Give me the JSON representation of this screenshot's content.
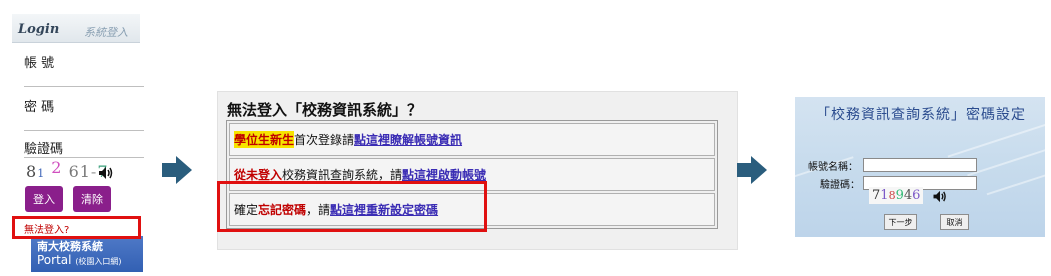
{
  "login_panel": {
    "logo_title": "Login",
    "logo_subtitle": "系統登入",
    "account_label": "帳 號",
    "password_label": "密 碼",
    "captcha_label": "驗證碼",
    "captcha_digits": [
      "8",
      "1",
      "2",
      "61",
      "7"
    ],
    "login_button": "登入",
    "clear_button": "清除",
    "cant_login_link": "無法登入?",
    "portal_line1": "南大校務系統",
    "portal_line2": "Portal",
    "portal_line2_small": "(校園入口網)"
  },
  "help_panel": {
    "title": "無法登入「校務資訊系統」？",
    "row1_highlight": "學位生新生",
    "row1_text": "首次登錄請",
    "row1_link": "點這裡瞭解帳號資訊",
    "row2_red": "從未登入",
    "row2_text": "校務資訊查詢系統，請",
    "row2_link": "點這裡啟動帳號",
    "row3_text_a": "確定",
    "row3_red": "忘記密碼",
    "row3_text_b": "，請",
    "row3_link": "點這裡重新設定密碼"
  },
  "reset_panel": {
    "title": "「校務資訊查詢系統」密碼設定",
    "account_label": "帳號名稱：",
    "captcha_label": "驗證碼：",
    "captcha_digits": [
      "7",
      "1",
      "8",
      "9",
      "4",
      "6"
    ],
    "next_button": "下一步",
    "cancel_button": "取消"
  },
  "colors": {
    "highlight_box": "#e01010",
    "arrow": "#2a5d7d",
    "login_buttons": "#8a1f8b",
    "portal": "#3c69bb",
    "link": "#3a2cb4"
  },
  "icons": [
    "speaker-icon",
    "right-arrow-icon"
  ]
}
